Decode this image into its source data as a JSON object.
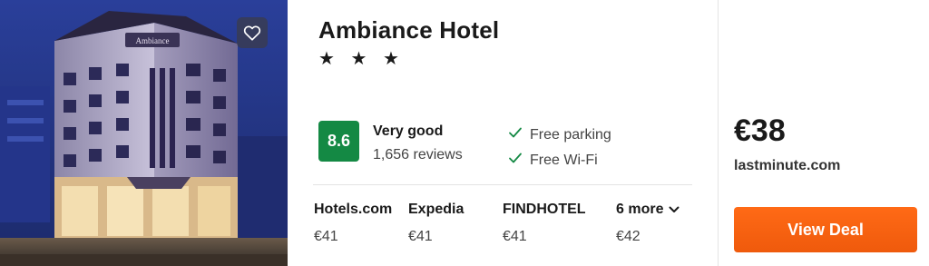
{
  "hotel": {
    "name": "Ambiance Hotel",
    "stars_display": "★ ★ ★",
    "star_count": 3,
    "sign_text": "Ambiance"
  },
  "rating": {
    "score": "8.6",
    "label": "Very good",
    "reviews": "1,656 reviews",
    "color": "#148944"
  },
  "amenities": [
    {
      "label": "Free parking",
      "icon": "check-icon"
    },
    {
      "label": "Free Wi-Fi",
      "icon": "check-icon"
    }
  ],
  "partners": [
    {
      "name": "Hotels.com",
      "price": "€41"
    },
    {
      "name": "Expedia",
      "price": "€41"
    },
    {
      "name": "FINDHOTEL",
      "price": "€41"
    },
    {
      "name": "6 more",
      "price": "€42"
    }
  ],
  "deal": {
    "price": "€38",
    "site": "lastminute.com",
    "button_label": "View Deal",
    "button_color": "#f4600f"
  },
  "favorite_icon": "heart-outline-icon"
}
